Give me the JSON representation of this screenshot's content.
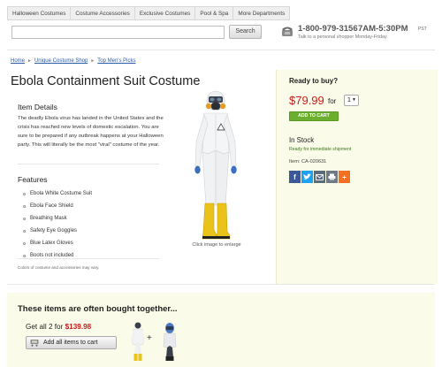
{
  "nav": {
    "tabs": [
      "Halloween Costumes",
      "Costume Accessories",
      "Exclusive Costumes",
      "Pool & Spa",
      "More Departments"
    ]
  },
  "search": {
    "value": "",
    "placeholder": "",
    "button_label": "Search"
  },
  "contact": {
    "phone": "1-800-979-3156",
    "hours": "7AM-5:30PM",
    "timezone": "PST",
    "subtext": "Talk to a personal shopper Monday-Friday"
  },
  "breadcrumb": [
    "Home",
    "Unique Costume Shop",
    "Top Men's Picks"
  ],
  "product": {
    "title": "Ebola Containment Suit Costume",
    "details_heading": "Item Details",
    "description": "The deadly Ebola virus has landed in the United States and the crisis has reached new levels of domestic escalation. You are sure to be prepared if any outbreak happens at your Halloween party. This will literally be the most \"viral\" costume of the year.",
    "features_heading": "Features",
    "features": [
      "Ebola White Costume Suit",
      "Ebola Face Shield",
      "Breathing Mask",
      "Safety Eye Goggles",
      "Blue Latex Gloves",
      "Boots not included"
    ],
    "disclaimer": "Colors of costume and accessories may vary.",
    "enlarge_caption": "Click image to enlarge"
  },
  "buy": {
    "heading": "Ready to buy?",
    "price": "$79.99",
    "for_label": "for",
    "quantity": "1",
    "add_to_cart": "ADD TO CART",
    "stock": "In Stock",
    "shipping": "Ready for immediate shipment",
    "item_number": "Item: CA-020631",
    "share_icons": [
      "facebook-icon",
      "twitter-icon",
      "email-icon",
      "print-icon",
      "plus-share-icon"
    ]
  },
  "together": {
    "heading": "These items are often bought together...",
    "get_all_prefix": "Get all 2 for",
    "get_all_price": "$139.98",
    "add_all_label": "Add all items to cart"
  },
  "colors": {
    "price_red": "#cc1a1a",
    "cart_green": "#6cae2d",
    "buybox_bg": "#fbfbe9",
    "link_blue": "#2a5aa8",
    "facebook": "#3b5998",
    "twitter": "#1da1f2",
    "email": "#5b6b7a",
    "print": "#6d7b86",
    "plus": "#f36f24"
  }
}
